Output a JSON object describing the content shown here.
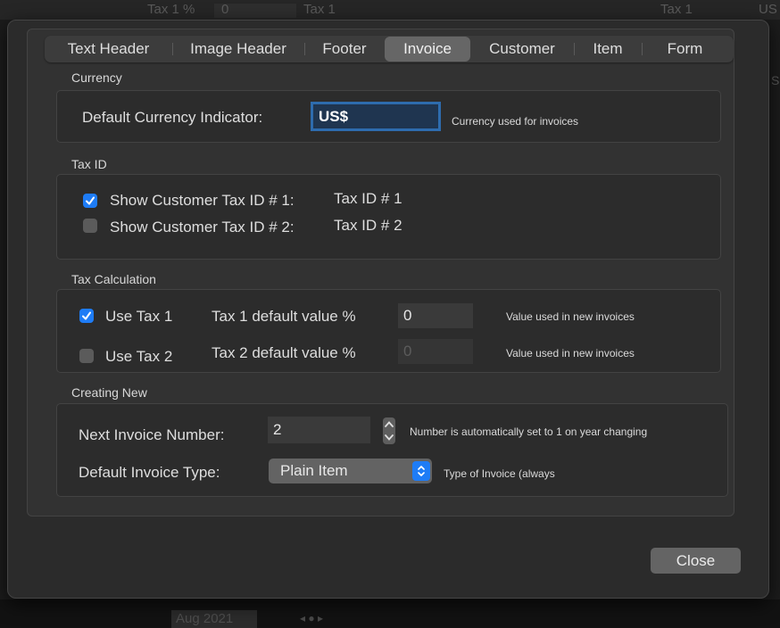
{
  "background": {
    "top_texts": [
      "Tax 1 %",
      "0",
      "Tax 1",
      "Tax 1",
      "US"
    ],
    "bottom_date": "Aug 2021",
    "right_char": "S"
  },
  "tabs": [
    {
      "label": "Text Header",
      "selected": false
    },
    {
      "label": "Image Header",
      "selected": false
    },
    {
      "label": "Footer",
      "selected": false
    },
    {
      "label": "Invoice",
      "selected": true
    },
    {
      "label": "Customer",
      "selected": false
    },
    {
      "label": "Item",
      "selected": false
    },
    {
      "label": "Form",
      "selected": false
    }
  ],
  "currency": {
    "section_title": "Currency",
    "label": "Default Currency Indicator:",
    "value": "US$",
    "hint": "Currency used for invoices"
  },
  "tax_id": {
    "section_title": "Tax ID",
    "show1_label": "Show Customer Tax ID # 1:",
    "show1_checked": true,
    "show1_value": "Tax ID # 1",
    "show2_label": "Show Customer Tax ID # 2:",
    "show2_checked": false,
    "show2_value": "Tax ID # 2"
  },
  "tax_calc": {
    "section_title": "Tax Calculation",
    "use_tax1_label": "Use Tax 1",
    "use_tax1_checked": true,
    "tax1_default_label": "Tax 1 default value %",
    "tax1_value": "0",
    "tax1_hint": "Value used in new invoices",
    "use_tax2_label": "Use Tax 2",
    "use_tax2_checked": false,
    "tax2_default_label": "Tax 2 default value %",
    "tax2_value": "0",
    "tax2_hint": "Value used in new invoices"
  },
  "creating_new": {
    "section_title": "Creating New",
    "next_number_label": "Next Invoice Number:",
    "next_number_value": "2",
    "next_number_hint": "Number is automatically set to 1 on year changing",
    "type_label": "Default Invoice Type:",
    "type_value": "Plain Item",
    "type_hint": "Type of Invoice (always"
  },
  "footer": {
    "close_label": "Close"
  },
  "colors": {
    "accent": "#1e7cf6",
    "focus_ring": "#2e6cae"
  }
}
